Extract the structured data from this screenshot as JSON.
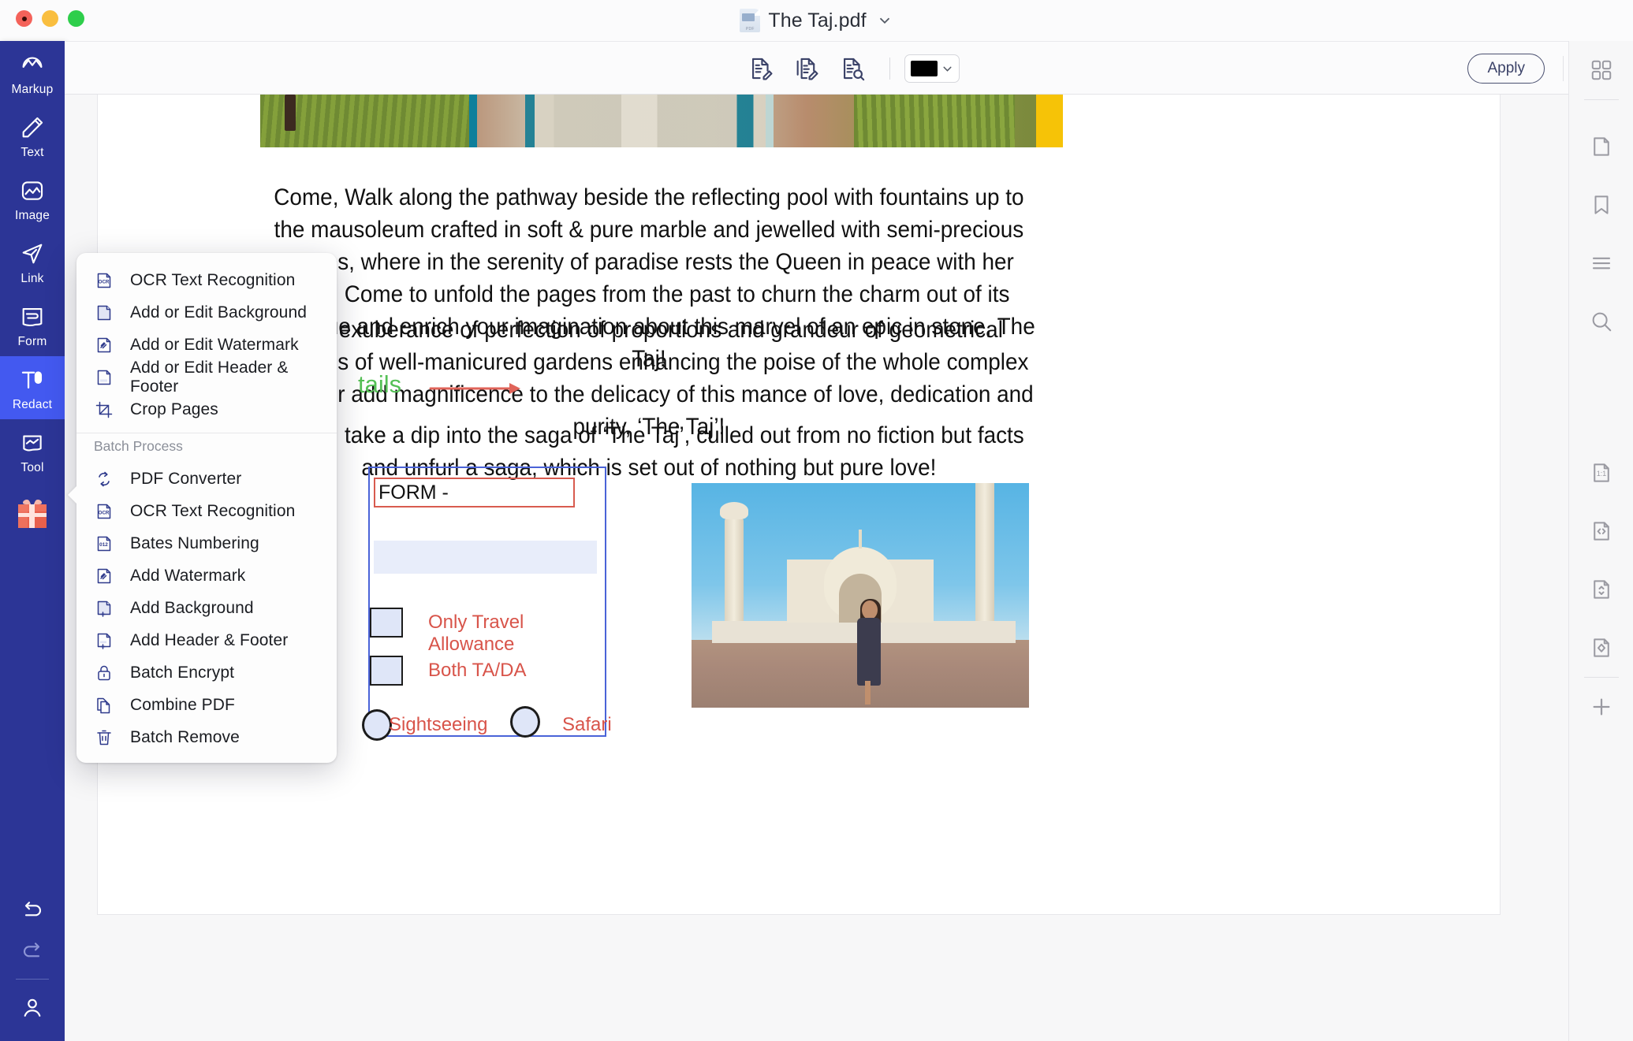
{
  "window": {
    "title": "The Taj.pdf",
    "title_chevron": "chevron-down",
    "traffic_lights": [
      "close",
      "minimize",
      "zoom"
    ]
  },
  "toolbar": {
    "buttons": [
      {
        "name": "edit-page-text",
        "icon": "document-pencil-icon"
      },
      {
        "name": "edit-all-pages-text",
        "icon": "documents-pencil-icon"
      },
      {
        "name": "search-document-text",
        "icon": "document-search-icon"
      }
    ],
    "color_picker": {
      "value": "#000000",
      "chevron": "chevron-down"
    },
    "apply_label": "Apply"
  },
  "sidebar": {
    "items": [
      {
        "label": "Markup",
        "icon": "markup-icon",
        "active": false
      },
      {
        "label": "Text",
        "icon": "pencil-icon",
        "active": false
      },
      {
        "label": "Image",
        "icon": "image-icon",
        "active": false
      },
      {
        "label": "Link",
        "icon": "link-arrow-icon",
        "active": false
      },
      {
        "label": "Form",
        "icon": "form-icon",
        "active": false
      },
      {
        "label": "Redact",
        "icon": "redact-icon",
        "active": true
      },
      {
        "label": "Tool",
        "icon": "tool-icon",
        "active": false
      }
    ],
    "gift_icon": "gift-icon",
    "bottom_icons": [
      "undo-icon",
      "redo-icon",
      "account-icon"
    ]
  },
  "rightbar": {
    "items": [
      {
        "name": "thumbnails-grid",
        "icon": "grid-icon"
      },
      {
        "name": "page-view",
        "icon": "page-icon"
      },
      {
        "name": "bookmarks",
        "icon": "bookmark-icon"
      },
      {
        "name": "outline",
        "icon": "list-icon"
      },
      {
        "name": "search",
        "icon": "search-icon"
      },
      {
        "name": "actual-size",
        "icon": "one-to-one-icon",
        "label": "1:1"
      },
      {
        "name": "fit-width",
        "icon": "fit-width-icon"
      },
      {
        "name": "fit-height",
        "icon": "fit-height-icon"
      },
      {
        "name": "fit-page",
        "icon": "fit-page-icon"
      },
      {
        "name": "add-page",
        "icon": "plus-icon"
      }
    ]
  },
  "menu": {
    "items": [
      {
        "label": "OCR Text Recognition",
        "icon": "ocr-doc-icon"
      },
      {
        "label": "Add or Edit Background",
        "icon": "background-doc-icon"
      },
      {
        "label": "Add or Edit Watermark",
        "icon": "watermark-doc-icon"
      },
      {
        "label": "Add or Edit Header & Footer",
        "icon": "header-footer-doc-icon"
      },
      {
        "label": "Crop Pages",
        "icon": "crop-icon"
      }
    ],
    "section_label": "Batch Process",
    "batch_items": [
      {
        "label": "PDF Converter",
        "icon": "convert-refresh-icon"
      },
      {
        "label": "OCR Text Recognition",
        "icon": "ocr-doc-icon"
      },
      {
        "label": "Bates Numbering",
        "icon": "bates-012-doc-icon"
      },
      {
        "label": "Add Watermark",
        "icon": "watermark-doc-icon"
      },
      {
        "label": "Add Background",
        "icon": "background-plus-doc-icon"
      },
      {
        "label": "Add Header & Footer",
        "icon": "header-footer-plus-doc-icon"
      },
      {
        "label": "Batch Encrypt",
        "icon": "lock-icon"
      },
      {
        "label": "Combine PDF",
        "icon": "copy-docs-icon"
      },
      {
        "label": "Batch Remove",
        "icon": "trash-icon"
      }
    ]
  },
  "document": {
    "paragraph_1": "Come, Walk along the pathway beside the reflecting pool with fountains up to the mausoleum crafted in soft & pure marble and jewelled with semi-precious stones, where in the serenity of paradise rests the Queen in peace with her King. Come to unfold the pages from the past to churn the charm out of its mystique and enrich your imagination about this marvel of an epic in stone, The Taj!",
    "paragraph_2": "The exuberance of perfection of proportions and grandeur of geometrical patterns of well-manicured gardens enhancing the poise of the whole complex together add magnificence to the delicacy of this mance of love, dedication and purity, ‘The Taj’!",
    "paragraph_3": "Come, take a dip into the saga of ‘The Taj’, culled out from no fiction but facts and unfurl a saga, which is set out of nothing but pure love!",
    "green_annotation": "tails",
    "arrow_annotation": "red-arrow",
    "form": {
      "title": "FORM -",
      "checkbox_labels": [
        "Only Travel Allowance",
        "Both TA/DA"
      ],
      "radio_labels": [
        "Sightseeing",
        "Safari"
      ]
    },
    "colors": {
      "green_text": "#55c056",
      "red_annotation": "#d8544a",
      "form_border": "#4a63d8",
      "accent_blue": "#2c3596",
      "active_blue": "#4359f0"
    }
  }
}
